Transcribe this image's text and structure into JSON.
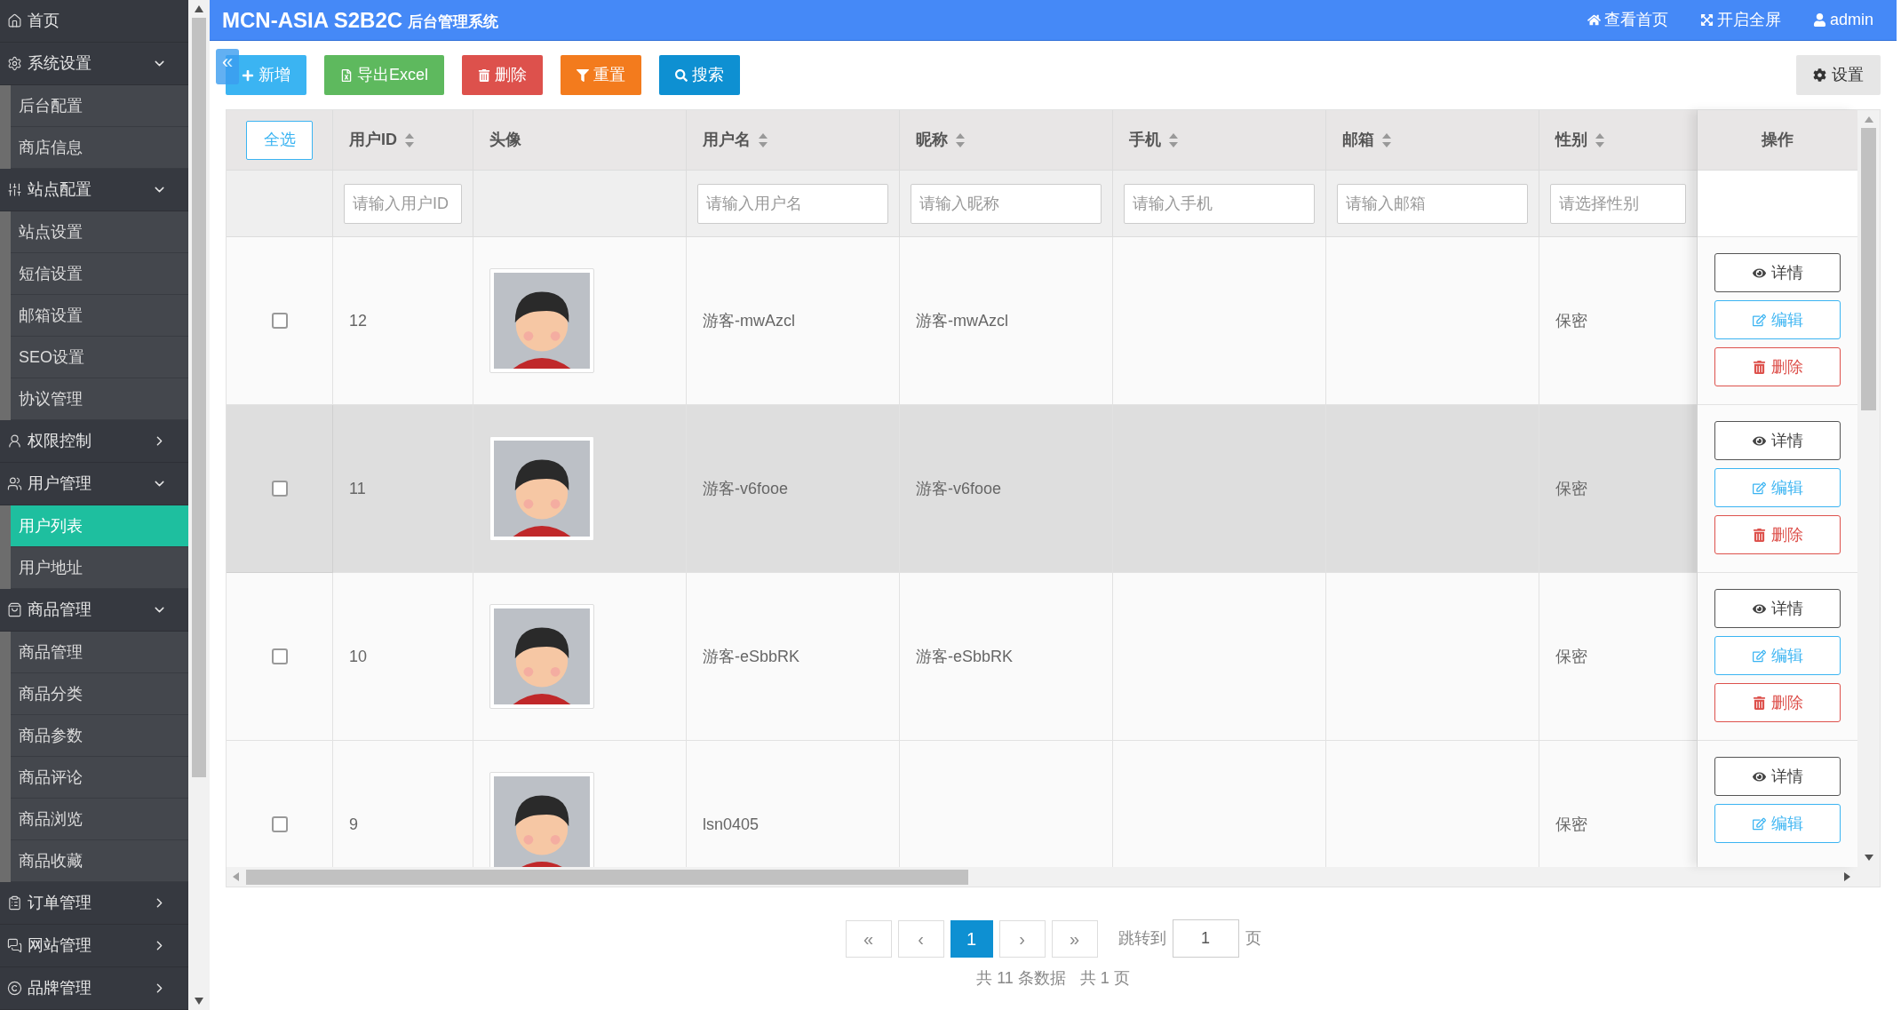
{
  "sidebar": {
    "items": [
      {
        "label": "首页"
      },
      {
        "label": "系统设置",
        "expanded": true,
        "children": [
          {
            "label": "后台配置",
            "selected": false
          },
          {
            "label": "商店信息",
            "selected": false
          }
        ]
      },
      {
        "label": "站点配置",
        "expanded": true,
        "children": [
          {
            "label": "站点设置",
            "selected": false
          },
          {
            "label": "短信设置",
            "selected": false
          },
          {
            "label": "邮箱设置",
            "selected": false
          },
          {
            "label": "SEO设置",
            "selected": false
          },
          {
            "label": "协议管理",
            "selected": false
          }
        ]
      },
      {
        "label": "权限控制",
        "expanded": false
      },
      {
        "label": "用户管理",
        "expanded": true,
        "children": [
          {
            "label": "用户列表",
            "selected": true
          },
          {
            "label": "用户地址",
            "selected": false
          }
        ]
      },
      {
        "label": "商品管理",
        "expanded": true,
        "children": [
          {
            "label": "商品管理",
            "selected": false
          },
          {
            "label": "商品分类",
            "selected": false
          },
          {
            "label": "商品参数",
            "selected": false
          },
          {
            "label": "商品评论",
            "selected": false
          },
          {
            "label": "商品浏览",
            "selected": false
          },
          {
            "label": "商品收藏",
            "selected": false
          }
        ]
      },
      {
        "label": "订单管理",
        "expanded": false
      },
      {
        "label": "网站管理",
        "expanded": false
      },
      {
        "label": "品牌管理",
        "expanded": false
      }
    ]
  },
  "header": {
    "title": "MCN-ASIA S2B2C",
    "subtitle": "后台管理系统",
    "links": [
      {
        "label": "查看首页",
        "kind": "home"
      },
      {
        "label": "开启全屏",
        "kind": "fullscreen"
      },
      {
        "label": "admin",
        "kind": "user"
      }
    ]
  },
  "collapse_toggle": "«",
  "toolbar": {
    "buttons": [
      {
        "label": "新增",
        "kind": "add"
      },
      {
        "label": "导出Excel",
        "kind": "export"
      },
      {
        "label": "删除",
        "kind": "delete"
      },
      {
        "label": "重置",
        "kind": "reset"
      },
      {
        "label": "搜索",
        "kind": "search"
      }
    ],
    "settings": "设置"
  },
  "table": {
    "select_all": "全选",
    "columns": [
      {
        "label": "用户ID",
        "sortable": true,
        "placeholder": "请输入用户ID"
      },
      {
        "label": "头像",
        "sortable": false
      },
      {
        "label": "用户名",
        "sortable": true,
        "placeholder": "请输入用户名"
      },
      {
        "label": "昵称",
        "sortable": true,
        "placeholder": "请输入昵称"
      },
      {
        "label": "手机",
        "sortable": true,
        "placeholder": "请输入手机"
      },
      {
        "label": "邮箱",
        "sortable": true,
        "placeholder": "请输入邮箱"
      },
      {
        "label": "性别",
        "sortable": true,
        "placeholder": "请选择性别"
      }
    ],
    "actions_header": "操作",
    "rows": [
      {
        "checked": false,
        "highlighted": false,
        "id": "12",
        "username": "游客-mwAzcl",
        "nickname": "游客-mwAzcl",
        "gender": "保密",
        "actions": [
          {
            "label": "详情",
            "kind": "view"
          },
          {
            "label": "编辑",
            "kind": "edit"
          },
          {
            "label": "删除",
            "kind": "delete"
          }
        ]
      },
      {
        "checked": false,
        "highlighted": true,
        "id": "11",
        "username": "游客-v6fooe",
        "nickname": "游客-v6fooe",
        "gender": "保密",
        "actions": [
          {
            "label": "详情",
            "kind": "view"
          },
          {
            "label": "编辑",
            "kind": "edit"
          },
          {
            "label": "删除",
            "kind": "delete"
          }
        ]
      },
      {
        "checked": false,
        "highlighted": false,
        "id": "10",
        "username": "游客-eSbbRK",
        "nickname": "游客-eSbbRK",
        "gender": "保密",
        "actions": [
          {
            "label": "详情",
            "kind": "view"
          },
          {
            "label": "编辑",
            "kind": "edit"
          },
          {
            "label": "删除",
            "kind": "delete"
          }
        ]
      },
      {
        "checked": false,
        "highlighted": false,
        "id": "9",
        "username": "lsn0405",
        "gender": "保密",
        "actions": [
          {
            "label": "详情",
            "kind": "view"
          },
          {
            "label": "编辑",
            "kind": "edit"
          }
        ]
      }
    ]
  },
  "pagination": {
    "first": "«",
    "prev": "‹",
    "pages": [
      {
        "label": "1",
        "selected": true
      }
    ],
    "next": "›",
    "last": "»",
    "goto_label": "跳转到",
    "goto_value": "1",
    "goto_suffix": "页",
    "total": "共 11 条数据",
    "page_count": "共 1 页"
  }
}
